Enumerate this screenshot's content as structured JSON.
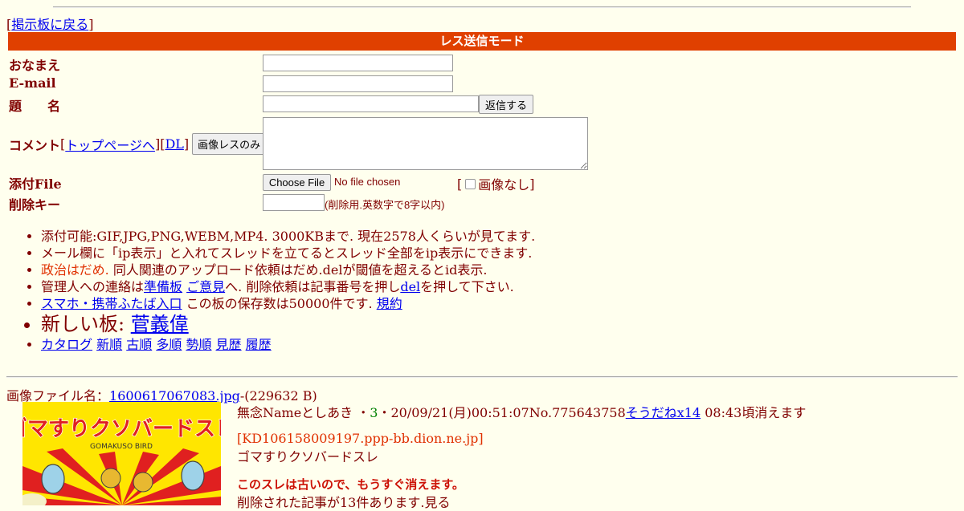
{
  "nav": {
    "back_open": "[",
    "back_link": "掲示板に戻る",
    "back_close": "]"
  },
  "form": {
    "mode_banner": "レス送信モード",
    "name_label": "おなまえ",
    "email_label": "E-mail",
    "subject_label": "題　　名",
    "submit_label": "返信する",
    "comment_label": "コメント",
    "top_link": "トップページへ",
    "dl_link": "DL",
    "image_only_label": "画像レスのみ",
    "attach_label": "添付File",
    "choose_file_label": "Choose File",
    "no_file_text": "No file chosen",
    "no_image_label": "画像なし",
    "delete_key_label": "削除キー",
    "delete_key_note": "(削除用.英数字で8字以内)"
  },
  "rules": {
    "r1": "添付可能:GIF,JPG,PNG,WEBM,MP4. 3000KBまで. 現在2578人くらいが見てます.",
    "r2": "メール欄に「ip表示」と入れてスレッドを立てるとスレッド全部をip表示にできます.",
    "r3_red": "政治はだめ.",
    "r3_rest": " 同人関連のアップロード依頼はだめ.delが閾値を超えるとid表示.",
    "r4_a": "管理人への連絡は",
    "r4_link1": "準備板",
    "r4_link2": "ご意見",
    "r4_b": "へ. 削除依頼は記事番号を押し",
    "r4_link3": "del",
    "r4_c": "を押して下さい.",
    "r5_link": "スマホ・携帯ふたば入口",
    "r5_text": " この板の保存数は50000件です. ",
    "r5_link2": "規約",
    "new_board_prefix": "新しい板: ",
    "new_board_link": "菅義偉",
    "views": [
      "カタログ",
      "新順",
      "古順",
      "多順",
      "勢順",
      "見歴",
      "履歴"
    ]
  },
  "thread": {
    "file_label": "画像ファイル名：",
    "file_name": "1600617067083.jpg",
    "file_size": "-(229632 B)",
    "poster": "無念Nameとしあき",
    "sodane_pre": " ・",
    "sodane_count": "3",
    "sodane_post": "・",
    "datetime": "20/09/21(月)00:51:07No.775643758",
    "sodane_link": "そうだねx14",
    "expire": " 08:43頃消えます",
    "ip": "KD106158009197.ppp-bb.dion.ne.jp",
    "subject": "ゴマすりクソバードスレ",
    "warning": "このスレは古いので、もうすぐ消えます。",
    "deleted_note": "削除された記事が13件あります.見る",
    "thumb_title": "ゴマすりクソバードスレ",
    "thumb_romaji": "GOMAKUSO BIRD"
  },
  "colors": {
    "background": "#FFFFEE",
    "text": "#800000",
    "banner": "#E04000",
    "link": "#0000EE",
    "warning_red": "#CC1105",
    "sodane_green": "#008000"
  }
}
